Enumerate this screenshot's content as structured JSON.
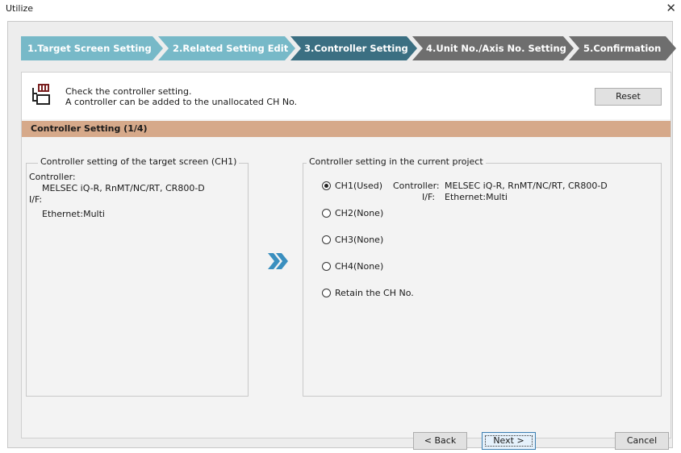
{
  "window": {
    "title": "Utilize"
  },
  "steps": [
    {
      "label": "1.Target Screen Setting"
    },
    {
      "label": "2.Related Setting Edit"
    },
    {
      "label": "3.Controller Setting"
    },
    {
      "label": "4.Unit No./Axis No. Setting"
    },
    {
      "label": "5.Confirmation"
    }
  ],
  "info": {
    "line1": "Check the controller setting.",
    "line2": "A controller can be added to the unallocated CH No.",
    "reset_label": "Reset"
  },
  "section": {
    "title": "Controller Setting (1/4)"
  },
  "left_group": {
    "title": "Controller setting of the target screen (CH1)",
    "controller_label": "Controller:",
    "controller_value": "MELSEC iQ-R, RnMT/NC/RT, CR800-D",
    "if_label": "I/F:",
    "if_value": "Ethernet:Multi"
  },
  "right_group": {
    "title": "Controller setting in the current project",
    "options": [
      {
        "label": "CH1(Used)",
        "checked": true
      },
      {
        "label": "CH2(None)",
        "checked": false
      },
      {
        "label": "CH3(None)",
        "checked": false
      },
      {
        "label": "CH4(None)",
        "checked": false
      },
      {
        "label": "Retain the CH No.",
        "checked": false
      }
    ],
    "ch1_detail": {
      "controller_label": "Controller:",
      "controller_value": "MELSEC iQ-R, RnMT/NC/RT, CR800-D",
      "if_label": "I/F:",
      "if_value": "Ethernet:Multi"
    }
  },
  "buttons": {
    "back": "< Back",
    "next": "Next >",
    "cancel": "Cancel"
  },
  "colors": {
    "step_done": "#77b9c8",
    "step_current": "#3b6f82",
    "step_pending": "#6e6e6e",
    "section_header": "#d6a98a",
    "arrow": "#3a8fbf"
  }
}
